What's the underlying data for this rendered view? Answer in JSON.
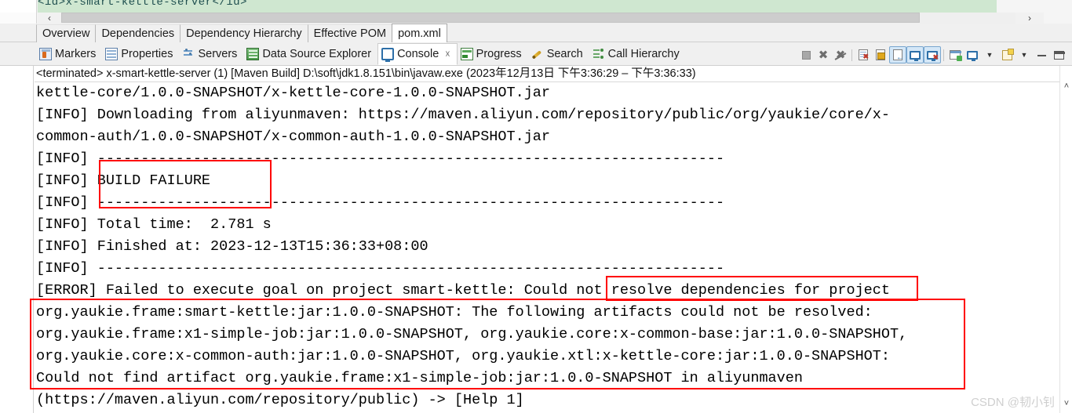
{
  "editor": {
    "peek_line": "<id>x-smart-kettle-server</id>",
    "hscroll_left_icon": "‹",
    "hscroll_right_icon": "›"
  },
  "form_tabs": [
    {
      "label": "Overview",
      "active": false
    },
    {
      "label": "Dependencies",
      "active": false
    },
    {
      "label": "Dependency Hierarchy",
      "active": false
    },
    {
      "label": "Effective POM",
      "active": false
    },
    {
      "label": "pom.xml",
      "active": true
    }
  ],
  "view_tabs": [
    {
      "label": "Markers",
      "icon": "markers-icon",
      "active": false,
      "closable": false
    },
    {
      "label": "Properties",
      "icon": "properties-icon",
      "active": false,
      "closable": false
    },
    {
      "label": "Servers",
      "icon": "servers-icon",
      "active": false,
      "closable": false
    },
    {
      "label": "Data Source Explorer",
      "icon": "data-source-explorer-icon",
      "active": false,
      "closable": false
    },
    {
      "label": "Console",
      "icon": "console-icon",
      "active": true,
      "closable": true,
      "close_glyph": "☓"
    },
    {
      "label": "Progress",
      "icon": "progress-icon",
      "active": false,
      "closable": false
    },
    {
      "label": "Search",
      "icon": "search-icon",
      "active": false,
      "closable": false
    },
    {
      "label": "Call Hierarchy",
      "icon": "call-hierarchy-icon",
      "active": false,
      "closable": false
    }
  ],
  "console_toolbar": [
    {
      "name": "terminate-button",
      "selected": false
    },
    {
      "name": "remove-launch-button",
      "selected": false
    },
    {
      "name": "remove-all-terminated-button",
      "selected": false
    },
    {
      "name": "clear-console-button",
      "selected": false
    },
    {
      "name": "scroll-lock-button",
      "selected": false
    },
    {
      "name": "word-wrap-button",
      "selected": true
    },
    {
      "name": "show-console-on-output-button",
      "selected": true
    },
    {
      "name": "show-console-on-error-button",
      "selected": true
    },
    {
      "name": "pin-console-button",
      "selected": false
    },
    {
      "name": "display-selected-console-button",
      "selected": false
    },
    {
      "name": "display-console-dropdown",
      "selected": false
    },
    {
      "name": "open-console-button",
      "selected": false
    },
    {
      "name": "open-console-dropdown",
      "selected": false
    },
    {
      "name": "minimize-button",
      "selected": false
    },
    {
      "name": "maximize-button",
      "selected": false
    }
  ],
  "console": {
    "header": "<terminated> x-smart-kettle-server (1) [Maven Build] D:\\soft\\jdk1.8.151\\bin\\javaw.exe  (2023年12月13日 下午3:36:29 – 下午3:36:33)",
    "lines": [
      "kettle-core/1.0.0-SNAPSHOT/x-kettle-core-1.0.0-SNAPSHOT.jar",
      "[INFO] Downloading from aliyunmaven: https://maven.aliyun.com/repository/public/org/yaukie/core/x-",
      "common-auth/1.0.0-SNAPSHOT/x-common-auth-1.0.0-SNAPSHOT.jar",
      "[INFO] ------------------------------------------------------------------------",
      "[INFO] BUILD FAILURE",
      "[INFO] ------------------------------------------------------------------------",
      "[INFO] Total time:  2.781 s",
      "[INFO] Finished at: 2023-12-13T15:36:33+08:00",
      "[INFO] ------------------------------------------------------------------------",
      "[ERROR] Failed to execute goal on project smart-kettle: Could not resolve dependencies for project",
      "org.yaukie.frame:smart-kettle:jar:1.0.0-SNAPSHOT: The following artifacts could not be resolved:",
      "org.yaukie.frame:x1-simple-job:jar:1.0.0-SNAPSHOT, org.yaukie.core:x-common-base:jar:1.0.0-SNAPSHOT,",
      "org.yaukie.core:x-common-auth:jar:1.0.0-SNAPSHOT, org.yaukie.xtl:x-kettle-core:jar:1.0.0-SNAPSHOT:",
      "Could not find artifact org.yaukie.frame:x1-simple-job:jar:1.0.0-SNAPSHOT in aliyunmaven",
      "(https://maven.aliyun.com/repository/public) -> [Help 1]"
    ],
    "scroll_up_glyph": "˄",
    "scroll_down_glyph": "˅"
  },
  "annotations": {
    "color": "#ff0000",
    "boxes": [
      {
        "name": "build-failure-highlight",
        "target": "BUILD FAILURE"
      },
      {
        "name": "could-not-resolve-dependencies-highlight",
        "target": "Could not resolve dependencies"
      },
      {
        "name": "unresolved-artifacts-highlight",
        "target": "unresolved artifact list"
      }
    ]
  },
  "watermark": {
    "text": "CSDN @韧小钊"
  }
}
